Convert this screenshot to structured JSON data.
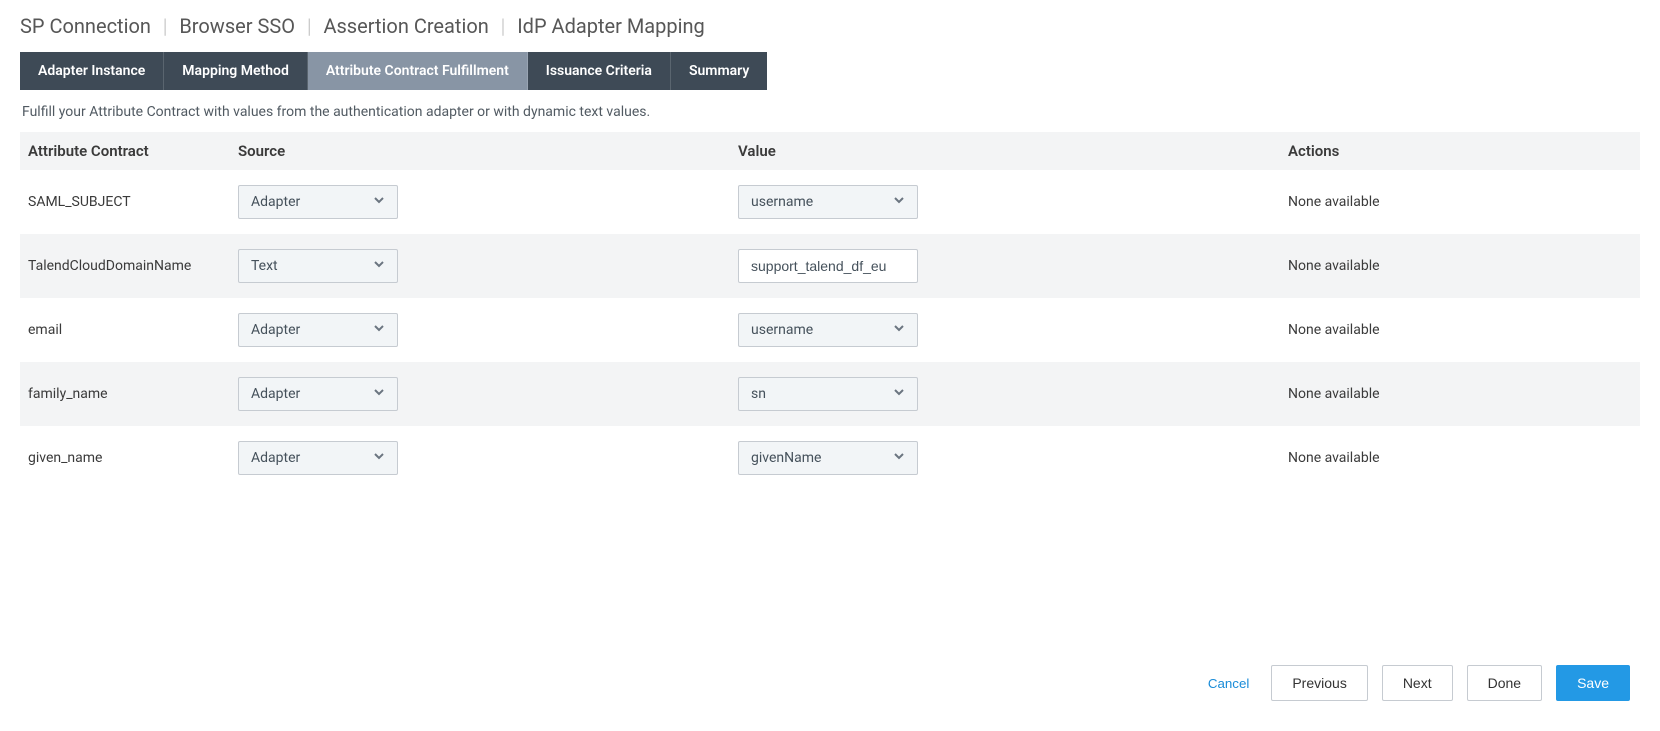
{
  "breadcrumb": [
    "SP Connection",
    "Browser SSO",
    "Assertion Creation",
    "IdP Adapter Mapping"
  ],
  "tabs": {
    "items": [
      {
        "label": "Adapter Instance",
        "active": false
      },
      {
        "label": "Mapping Method",
        "active": false
      },
      {
        "label": "Attribute Contract Fulfillment",
        "active": true
      },
      {
        "label": "Issuance Criteria",
        "active": false
      },
      {
        "label": "Summary",
        "active": false
      }
    ]
  },
  "description": "Fulfill your Attribute Contract with values from the authentication adapter or with dynamic text values.",
  "table": {
    "headers": {
      "contract": "Attribute Contract",
      "source": "Source",
      "value": "Value",
      "actions": "Actions"
    },
    "rows": [
      {
        "name": "SAML_SUBJECT",
        "source": "Adapter",
        "valueType": "select",
        "value": "username",
        "actions": "None available",
        "shade": false
      },
      {
        "name": "TalendCloudDomainName",
        "source": "Text",
        "valueType": "text",
        "value": "support_talend_df_eu",
        "actions": "None available",
        "shade": true
      },
      {
        "name": "email",
        "source": "Adapter",
        "valueType": "select",
        "value": "username",
        "actions": "None available",
        "shade": false
      },
      {
        "name": "family_name",
        "source": "Adapter",
        "valueType": "select",
        "value": "sn",
        "actions": "None available",
        "shade": true
      },
      {
        "name": "given_name",
        "source": "Adapter",
        "valueType": "select",
        "value": "givenName",
        "actions": "None available",
        "shade": false
      }
    ]
  },
  "footer": {
    "cancel": "Cancel",
    "previous": "Previous",
    "next": "Next",
    "done": "Done",
    "save": "Save"
  }
}
